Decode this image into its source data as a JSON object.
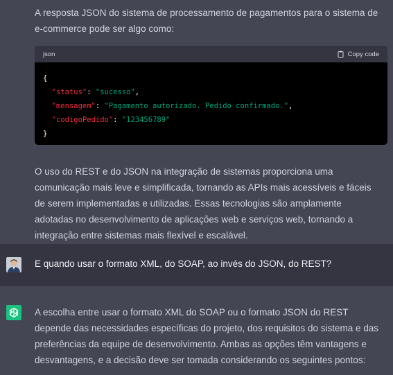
{
  "intro_text": "A resposta JSON do sistema de processamento de pagamentos para o sistema de e-commerce pode ser algo como:",
  "code": {
    "language": "json",
    "copy_label": "Copy code",
    "open_brace": "{",
    "close_brace": "}",
    "lines": [
      {
        "key": "\"status\"",
        "sep": ": ",
        "value": "\"sucesso\"",
        "trail": ","
      },
      {
        "key": "\"mensagem\"",
        "sep": ": ",
        "value": "\"Pagamento autorizado. Pedido confirmado.\"",
        "trail": ","
      },
      {
        "key": "\"codigoPedido\"",
        "sep": ": ",
        "value": "\"123456789\"",
        "trail": ""
      }
    ]
  },
  "summary_text": "O uso do REST e do JSON na integração de sistemas proporciona uma comunicação mais leve e simplificada, tornando as APIs mais acessíveis e fáceis de serem implementadas e utilizadas. Essas tecnologias são amplamente adotadas no desenvolvimento de aplicações web e serviços web, tornando a integração entre sistemas mais flexível e escalável.",
  "user_message": "E quando usar o formato XML, do SOAP, ao invés do JSON, do REST?",
  "answer_text": "A escolha entre usar o formato XML do SOAP ou o formato JSON do REST depende das necessidades específicas do projeto, dos requisitos do sistema e das preferências da equipe de desenvolvimento. Ambas as opções têm vantagens e desvantagens, e a decisão deve ser tomada considerando os seguintes pontos:",
  "colors": {
    "assistant_bg": "#444654",
    "user_bg": "#343541",
    "code_key": "#f22c3d",
    "code_string": "#00a67d",
    "gpt_green": "#19c37d"
  }
}
